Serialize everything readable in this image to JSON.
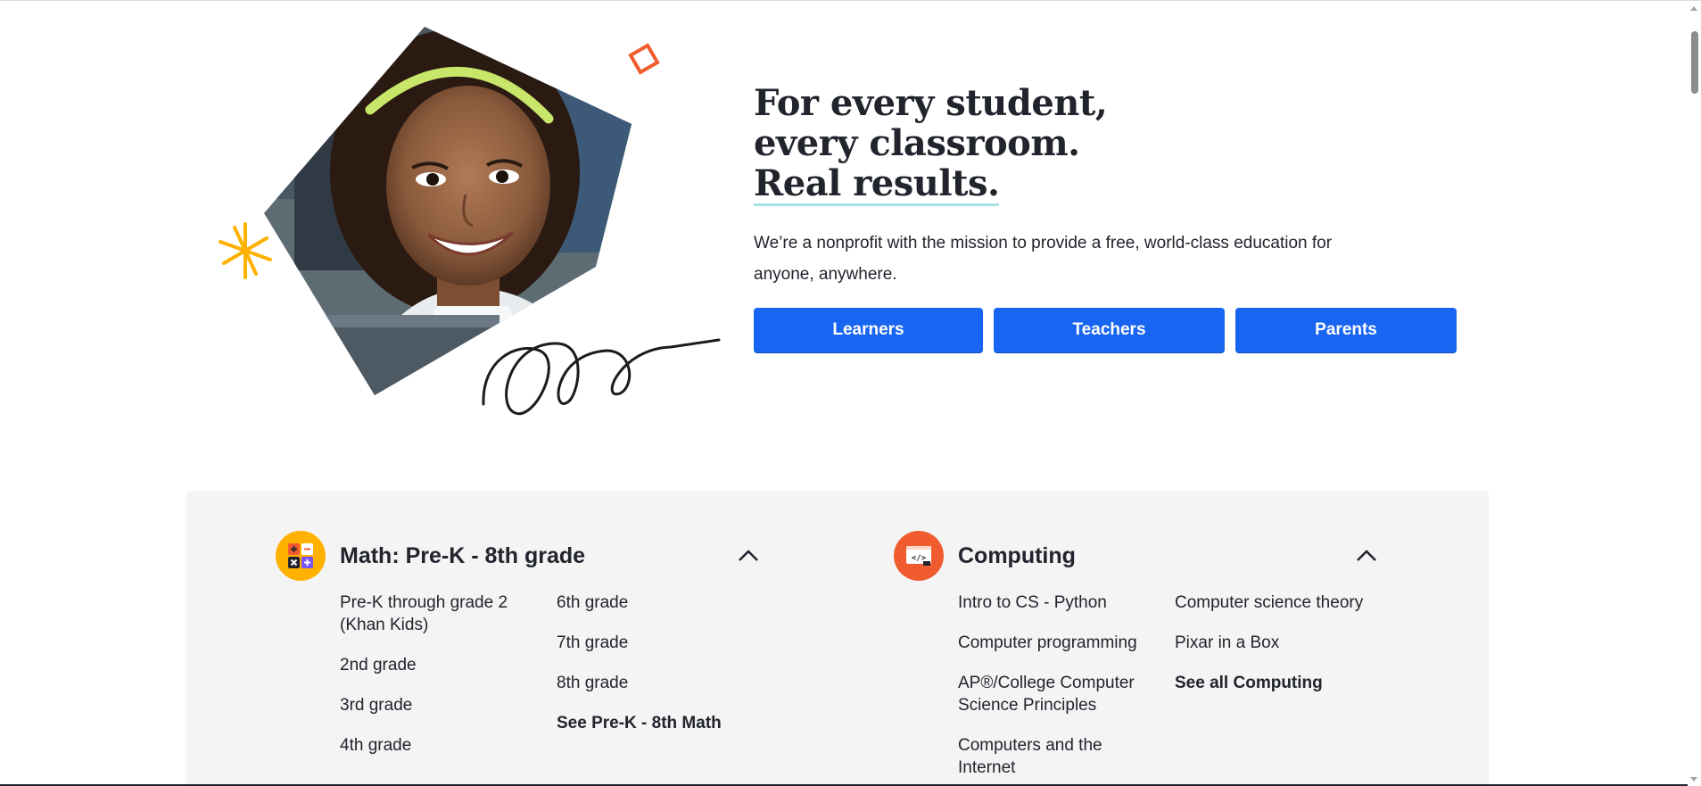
{
  "hero": {
    "headline_line1": "For every student,",
    "headline_line2": "every classroom.",
    "headline_line3": "Real results.",
    "mission": "We’re a nonprofit with the mission to provide a free, world-class education for anyone, anywhere.",
    "buttons": [
      {
        "label": "Learners"
      },
      {
        "label": "Teachers"
      },
      {
        "label": "Parents"
      }
    ],
    "image": "smiling-student-photo"
  },
  "catalog": {
    "math": {
      "title": "Math: Pre-K - 8th grade",
      "icon": "calculator-icon",
      "column1": [
        "Pre-K through grade 2 (Khan Kids)",
        "2nd grade",
        "3rd grade",
        "4th grade"
      ],
      "column2": [
        "6th grade",
        "7th grade",
        "8th grade"
      ],
      "see_all": "See Pre-K - 8th Math"
    },
    "computing": {
      "title": "Computing",
      "icon": "code-icon",
      "column1": [
        "Intro to CS - Python",
        "Computer programming",
        "AP®/College Computer Science Principles",
        "Computers and the Internet"
      ],
      "column2": [
        "Computer science theory",
        "Pixar in a Box"
      ],
      "see_all": "See all Computing"
    }
  },
  "colors": {
    "accent": "#1865f2",
    "math_badge": "#ffb100",
    "computing_badge": "#f15c2e",
    "panel_bg": "#f4f4f5",
    "underline": "#a9e1e6"
  }
}
